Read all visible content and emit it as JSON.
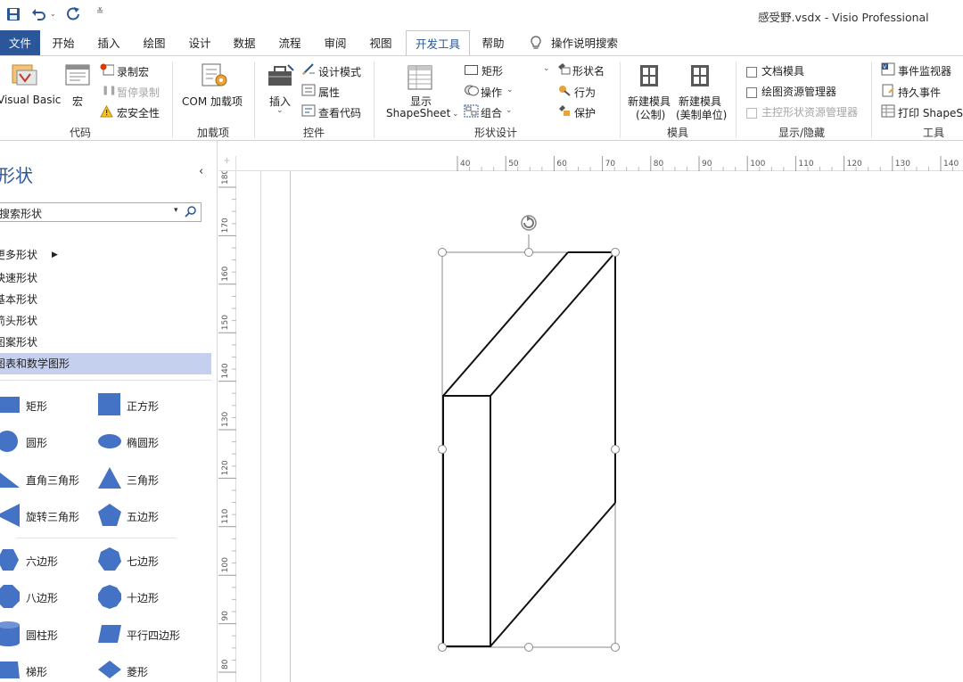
{
  "window": {
    "title": "感受野.vsdx  -  Visio Professional"
  },
  "qat": {
    "icons": [
      "save-icon",
      "undo-icon",
      "redo-icon",
      "customize-icon"
    ]
  },
  "tabs": [
    "文件",
    "开始",
    "插入",
    "绘图",
    "设计",
    "数据",
    "流程",
    "审阅",
    "视图",
    "开发工具",
    "帮助"
  ],
  "tell_me": "操作说明搜索",
  "ribbon": {
    "code": {
      "visual_basic": "Visual Basic",
      "macros": "宏",
      "record_macro": "录制宏",
      "pause_recording": "暂停录制",
      "macro_security": "宏安全性",
      "group": "代码"
    },
    "addins": {
      "com_addins": "COM 加载项",
      "group": "加载项"
    },
    "controls": {
      "insert": "插入",
      "design_mode": "设计模式",
      "properties": "属性",
      "view_code": "查看代码",
      "group": "控件"
    },
    "shape_design": {
      "show_shapesheet_1": "显示",
      "show_shapesheet_2": "ShapeSheet",
      "rectangle": "矩形",
      "operations": "操作",
      "group_cmd": "组合",
      "shape_name": "形状名",
      "behavior": "行为",
      "protection": "保护",
      "group": "形状设计"
    },
    "stencil": {
      "new_metric_1": "新建模具",
      "new_metric_2": "(公制)",
      "new_us_1": "新建模具",
      "new_us_2": "(美制单位)",
      "group": "模具"
    },
    "showhide": {
      "doc_stencil": "文档模具",
      "drawing_explorer": "绘图资源管理器",
      "master_explorer": "主控形状资源管理器",
      "group": "显示/隐藏"
    },
    "tools": {
      "event_monitor": "事件监视器",
      "persistent_events": "持久事件",
      "print_shapesheet": "打印 ShapeSh",
      "group": "工具"
    }
  },
  "shapes_panel": {
    "title": "形状",
    "search_placeholder": "搜索形状",
    "nav": [
      "更多形状",
      "快速形状",
      "基本形状",
      "箭头形状",
      "图案形状",
      "图表和数学图形"
    ],
    "selected_nav": "图表和数学图形",
    "shapes": [
      "矩形",
      "正方形",
      "圆形",
      "椭圆形",
      "直角三角形",
      "三角形",
      "旋转三角形",
      "五边形",
      "六边形",
      "七边形",
      "八边形",
      "十边形",
      "圆柱形",
      "平行四边形",
      "梯形",
      "菱形"
    ]
  },
  "ruler": {
    "horizontal": [
      "40",
      "50",
      "60",
      "70",
      "80",
      "90",
      "100",
      "110",
      "120",
      "130",
      "140"
    ],
    "vertical": [
      "180",
      "170",
      "160",
      "150",
      "140",
      "130",
      "120",
      "110",
      "100",
      "90",
      "80"
    ]
  },
  "colors": {
    "accent": "#2b579a",
    "shape_fill": "#4472c4",
    "selected_nav": "#c5d0ee"
  }
}
